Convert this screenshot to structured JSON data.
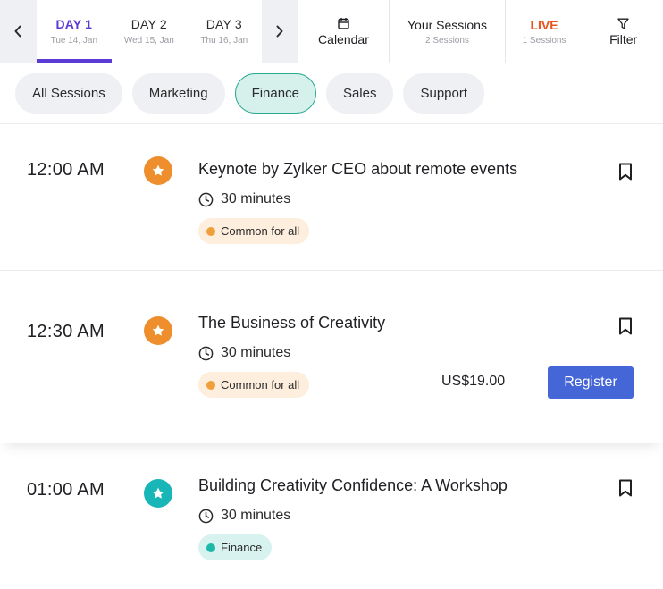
{
  "nav": {
    "prev_icon": "chevron-left-icon",
    "next_icon": "chevron-right-icon"
  },
  "days": [
    {
      "label": "DAY 1",
      "date": "Tue 14, Jan",
      "active": true
    },
    {
      "label": "DAY 2",
      "date": "Wed 15, Jan",
      "active": false
    },
    {
      "label": "DAY 3",
      "date": "Thu 16, Jan",
      "active": false
    }
  ],
  "top_items": {
    "calendar": {
      "label": "Calendar",
      "icon": "calendar-icon"
    },
    "your_sessions": {
      "label": "Your Sessions",
      "sub": "2 Sessions"
    },
    "live": {
      "label": "LIVE",
      "sub": "1 Sessions"
    },
    "filter": {
      "label": "Filter",
      "icon": "filter-icon"
    }
  },
  "chips": [
    {
      "label": "All Sessions",
      "active": false
    },
    {
      "label": "Marketing",
      "active": false
    },
    {
      "label": "Finance",
      "active": true
    },
    {
      "label": "Sales",
      "active": false
    },
    {
      "label": "Support",
      "active": false
    }
  ],
  "sessions": [
    {
      "time": "12:00 AM",
      "title": "Keynote by Zylker CEO about remote events",
      "duration": "30 minutes",
      "tag": "Common for all",
      "tag_color": "#f0a03a",
      "tag_bg": "#fdeedd",
      "dot_color": "#ef8e2c",
      "icon": "star-icon",
      "price": "",
      "register": ""
    },
    {
      "time": "12:30 AM",
      "title": "The Business of Creativity",
      "duration": "30 minutes",
      "tag": "Common for all",
      "tag_color": "#f0a03a",
      "tag_bg": "#fdeedd",
      "dot_color": "#ef8e2c",
      "icon": "star-icon",
      "price": "US$19.00",
      "register": "Register"
    },
    {
      "time": "01:00 AM",
      "title": "Building Creativity Confidence: A Workshop",
      "duration": "30 minutes",
      "tag": "Finance",
      "tag_color": "#1cb8a8",
      "tag_bg": "#d8f3ef",
      "dot_color": "#19b6b8",
      "icon": "star-icon",
      "price": "",
      "register": ""
    }
  ],
  "colors": {
    "accent": "#5b3bd4",
    "live": "#e8541e",
    "register": "#4466d6",
    "chip_active_border": "#2aa991"
  }
}
